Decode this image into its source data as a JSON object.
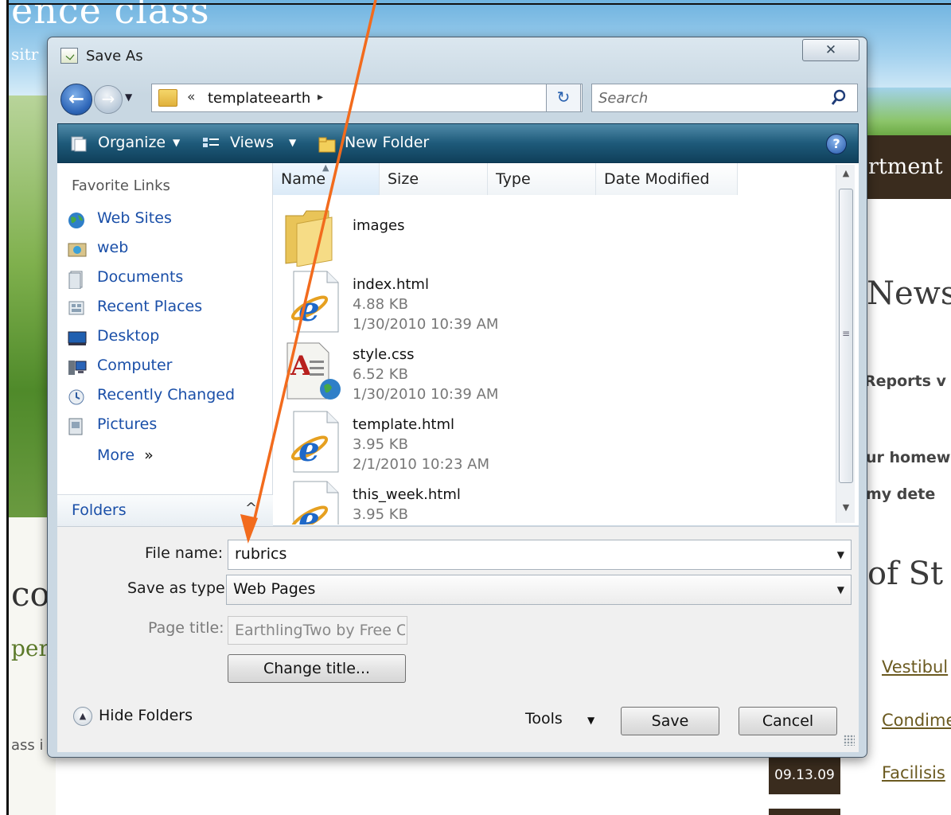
{
  "background": {
    "site_title": "ence class",
    "site_subtitle": "sitr",
    "dept_text": "rtment",
    "news_heading": "News",
    "reports_text": "Reports v",
    "homework_text": "ur homew",
    "detect_text": "my dete",
    "of_students_heading": "of St",
    "links": [
      "Vestibul",
      "Condime",
      "Facilisis"
    ],
    "date_badge": "09.13.09",
    "left_co": "co",
    "left_per": "per",
    "left_ass": "ass i"
  },
  "dialog": {
    "title": "Save As",
    "close_glyph": "✕",
    "address": {
      "chevron": "«",
      "breadcrumb": "templateearth",
      "arrow": "▸",
      "dropdown": "▼",
      "refresh": "↻"
    },
    "search_placeholder": "Search",
    "toolbar": {
      "organize": "Organize",
      "views": "Views",
      "new_folder": "New Folder",
      "dropdown": "▼",
      "help": "?"
    },
    "nav": {
      "heading": "Favorite Links",
      "items": [
        {
          "label": "Web Sites",
          "icon": "globe-icon"
        },
        {
          "label": "web",
          "icon": "picture-folder-icon"
        },
        {
          "label": "Documents",
          "icon": "documents-icon"
        },
        {
          "label": "Recent Places",
          "icon": "recent-places-icon"
        },
        {
          "label": "Desktop",
          "icon": "desktop-icon"
        },
        {
          "label": "Computer",
          "icon": "computer-icon"
        },
        {
          "label": "Recently Changed",
          "icon": "recently-changed-icon"
        },
        {
          "label": "Pictures",
          "icon": "pictures-icon"
        }
      ],
      "more": "More",
      "more_glyph": "»",
      "folders_label": "Folders",
      "folders_chevron": "^"
    },
    "columns": [
      "Name",
      "Size",
      "Type",
      "Date Modified"
    ],
    "files": [
      {
        "name": "images",
        "size": "",
        "date": "",
        "icon": "folder-icon"
      },
      {
        "name": "index.html",
        "size": "4.88 KB",
        "date": "1/30/2010 10:39 AM",
        "icon": "ie-document-icon"
      },
      {
        "name": "style.css",
        "size": "6.52 KB",
        "date": "1/30/2010 10:39 AM",
        "icon": "css-document-icon"
      },
      {
        "name": "template.html",
        "size": "3.95 KB",
        "date": "2/1/2010 10:23 AM",
        "icon": "ie-document-icon"
      },
      {
        "name": "this_week.html",
        "size": "3.95 KB",
        "date": "",
        "icon": "ie-document-icon"
      }
    ],
    "scroll": {
      "up": "▲",
      "down": "▼",
      "grip": "≡"
    },
    "form": {
      "file_name_label": "File name:",
      "file_name_value": "rubrics",
      "save_as_type_label": "Save as type:",
      "save_as_type_value": "Web Pages",
      "page_title_label": "Page title:",
      "page_title_value": "EarthlingTwo by Free CS",
      "change_title_button": "Change title...",
      "hide_folders": "Hide Folders",
      "hide_folders_glyph": "▲",
      "tools": "Tools",
      "tools_dd": "▼",
      "save_button": "Save",
      "cancel_button": "Cancel",
      "dd": "▼"
    }
  },
  "colors": {
    "annotation_arrow": "#f26b1d",
    "toolbar": "#1e5a7a",
    "link": "#1a4fa8"
  }
}
